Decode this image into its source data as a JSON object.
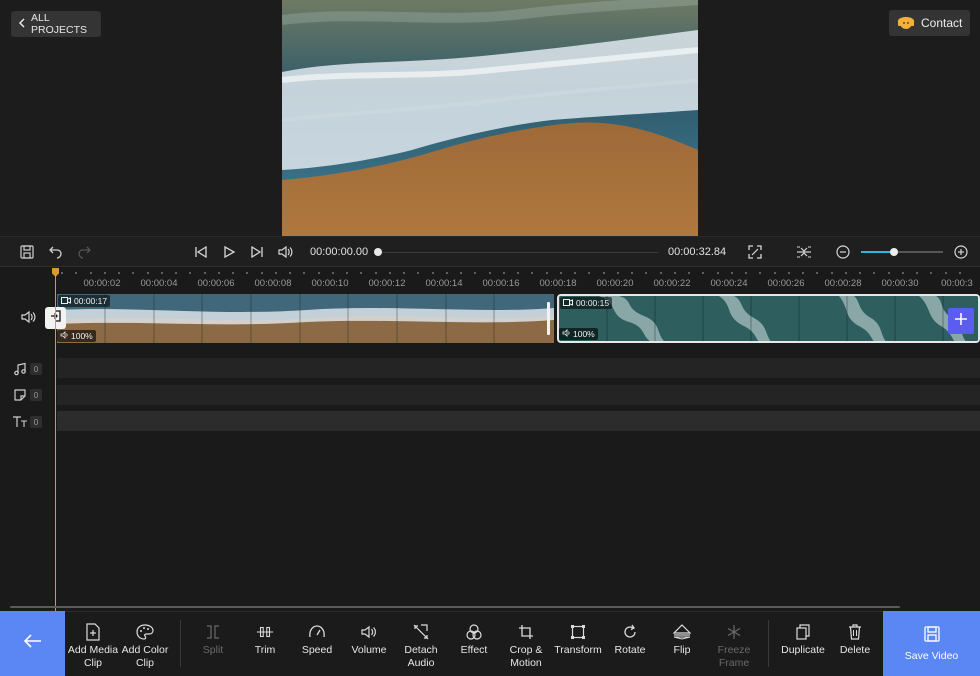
{
  "header": {
    "back_label": "ALL PROJECTS",
    "contact_label": "Contact"
  },
  "player": {
    "current_time": "00:00:00.00",
    "total_time": "00:00:32.84",
    "progress": 0,
    "zoom_level_fraction": 0.4
  },
  "ruler": {
    "labels": [
      "00:00:02",
      "00:00:04",
      "00:00:06",
      "00:00:08",
      "00:00:10",
      "00:00:12",
      "00:00:14",
      "00:00:16",
      "00:00:18",
      "00:00:20",
      "00:00:22",
      "00:00:24",
      "00:00:26",
      "00:00:28",
      "00:00:30",
      "00:00:3"
    ]
  },
  "clips": [
    {
      "duration": "00:00:17",
      "volume": "100%"
    },
    {
      "duration": "00:00:15",
      "volume": "100%"
    }
  ],
  "lanes": {
    "music_count": "0",
    "sticker_count": "0",
    "text_count": "0"
  },
  "toolbar": {
    "add_media": "Add Media\nClip",
    "add_color": "Add Color\nClip",
    "split": "Split",
    "trim": "Trim",
    "speed": "Speed",
    "volume": "Volume",
    "detach_audio": "Detach\nAudio",
    "effect": "Effect",
    "crop_motion": "Crop &\nMotion",
    "transform": "Transform",
    "rotate": "Rotate",
    "flip": "Flip",
    "freeze_frame": "Freeze\nFrame",
    "duplicate": "Duplicate",
    "delete": "Delete",
    "save_video": "Save Video"
  },
  "colors": {
    "accent": "#5a87f4",
    "playhead": "#d89a2a",
    "zoom_fill": "#2fb3e0",
    "add_button": "#5b5cf0"
  }
}
